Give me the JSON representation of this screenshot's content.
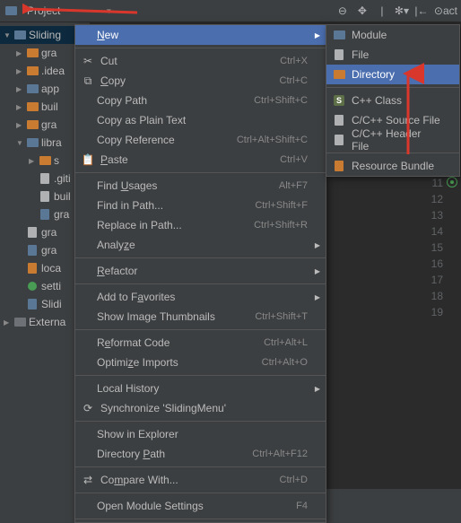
{
  "toolbar": {
    "project_label": "Project",
    "act_label": "act"
  },
  "tree": {
    "root": "Sliding",
    "items": [
      "gra",
      ".idea",
      "app",
      "buil",
      "gra",
      "libra",
      "s",
      ".giti",
      "buil",
      "gra",
      "gra",
      "gra",
      "loca",
      "setti",
      "Slidi"
    ],
    "external": "Externa"
  },
  "context": {
    "new": "New",
    "cut": "Cut",
    "cut_s": "Ctrl+X",
    "copy": "Copy",
    "copy_s": "Ctrl+C",
    "copy_path": "Copy Path",
    "copy_path_s": "Ctrl+Shift+C",
    "copy_plain": "Copy as Plain Text",
    "copy_ref": "Copy Reference",
    "copy_ref_s": "Ctrl+Alt+Shift+C",
    "paste": "Paste",
    "paste_s": "Ctrl+V",
    "find_usages": "Find Usages",
    "find_usages_s": "Alt+F7",
    "find_in_path": "Find in Path...",
    "find_in_path_s": "Ctrl+Shift+F",
    "replace_in_path": "Replace in Path...",
    "replace_in_path_s": "Ctrl+Shift+R",
    "analyze": "Analyze",
    "refactor": "Refactor",
    "add_fav": "Add to Favorites",
    "show_thumb": "Show Image Thumbnails",
    "show_thumb_s": "Ctrl+Shift+T",
    "reformat": "Reformat Code",
    "reformat_s": "Ctrl+Alt+L",
    "optimize": "Optimize Imports",
    "optimize_s": "Ctrl+Alt+O",
    "local_hist": "Local History",
    "sync": "Synchronize 'SlidingMenu'",
    "show_explorer": "Show in Explorer",
    "dir_path": "Directory Path",
    "dir_path_s": "Ctrl+Alt+F12",
    "compare": "Compare With...",
    "compare_s": "Ctrl+D",
    "open_module": "Open Module Settings",
    "open_module_s": "F4"
  },
  "submenu": {
    "module": "Module",
    "file": "File",
    "directory": "Directory",
    "cpp_class": "C++ Class",
    "cpp_source": "C/C++ Source File",
    "cpp_header": "C/C++ Header File",
    "resource_bundle": "Resource Bundle"
  },
  "gutter": [
    "11",
    "12",
    "13",
    "14",
    "15",
    "16",
    "17",
    "18",
    "19"
  ]
}
